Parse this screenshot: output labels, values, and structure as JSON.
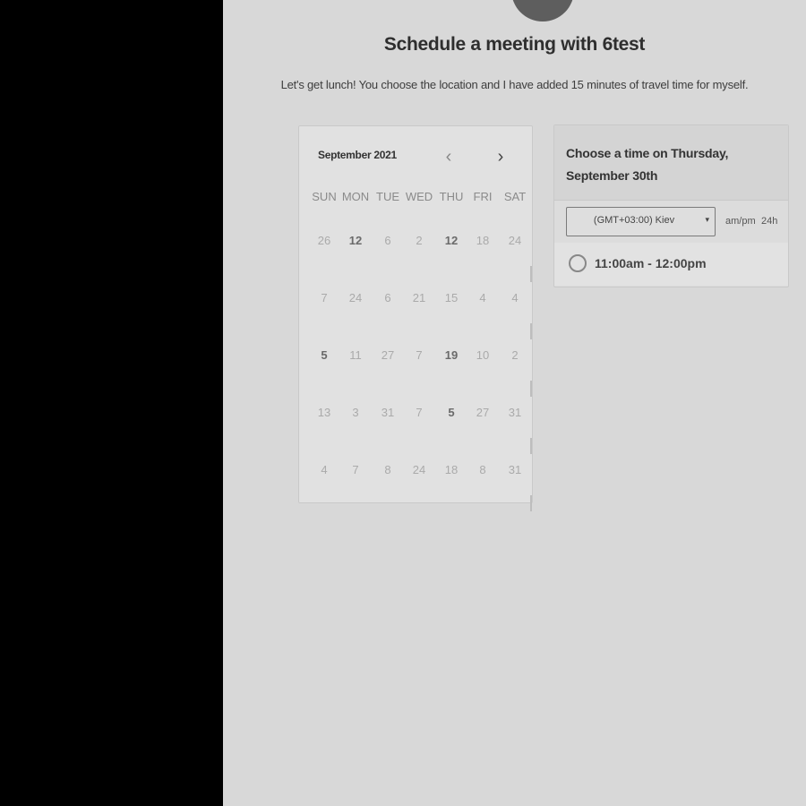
{
  "header": {
    "title": "Schedule a meeting with 6test",
    "subtitle": "Let's get lunch! You choose the location and I have added 15 minutes of travel time for myself."
  },
  "calendar": {
    "month_label": "September 2021",
    "prev_icon": "‹",
    "next_icon": "›",
    "weekdays": [
      "SUN",
      "MON",
      "TUE",
      "WED",
      "THU",
      "FRI",
      "SAT"
    ],
    "weeks": [
      [
        {
          "d": "26",
          "a": false
        },
        {
          "d": "12",
          "a": true
        },
        {
          "d": "6",
          "a": false
        },
        {
          "d": "2",
          "a": false
        },
        {
          "d": "12",
          "a": true
        },
        {
          "d": "18",
          "a": false
        },
        {
          "d": "24",
          "a": false
        }
      ],
      [
        {
          "d": "7",
          "a": false
        },
        {
          "d": "24",
          "a": false
        },
        {
          "d": "6",
          "a": false
        },
        {
          "d": "21",
          "a": false
        },
        {
          "d": "15",
          "a": false
        },
        {
          "d": "4",
          "a": false
        },
        {
          "d": "4",
          "a": false
        }
      ],
      [
        {
          "d": "5",
          "a": true
        },
        {
          "d": "11",
          "a": false
        },
        {
          "d": "27",
          "a": false
        },
        {
          "d": "7",
          "a": false
        },
        {
          "d": "19",
          "a": true
        },
        {
          "d": "10",
          "a": false
        },
        {
          "d": "2",
          "a": false
        }
      ],
      [
        {
          "d": "13",
          "a": false
        },
        {
          "d": "3",
          "a": false
        },
        {
          "d": "31",
          "a": false
        },
        {
          "d": "7",
          "a": false
        },
        {
          "d": "5",
          "a": true
        },
        {
          "d": "27",
          "a": false
        },
        {
          "d": "31",
          "a": false
        }
      ],
      [
        {
          "d": "4",
          "a": false
        },
        {
          "d": "7",
          "a": false
        },
        {
          "d": "8",
          "a": false
        },
        {
          "d": "24",
          "a": false
        },
        {
          "d": "18",
          "a": false
        },
        {
          "d": "8",
          "a": false
        },
        {
          "d": "31",
          "a": false
        }
      ]
    ]
  },
  "time_panel": {
    "heading": "Choose a time on Thursday, September 30th",
    "timezone": "(GMT+03:00) Kiev",
    "caret_icon": "▾",
    "format_ampm": "am/pm",
    "format_24h": "24h",
    "slots": [
      "11:00am - 12:00pm"
    ]
  }
}
